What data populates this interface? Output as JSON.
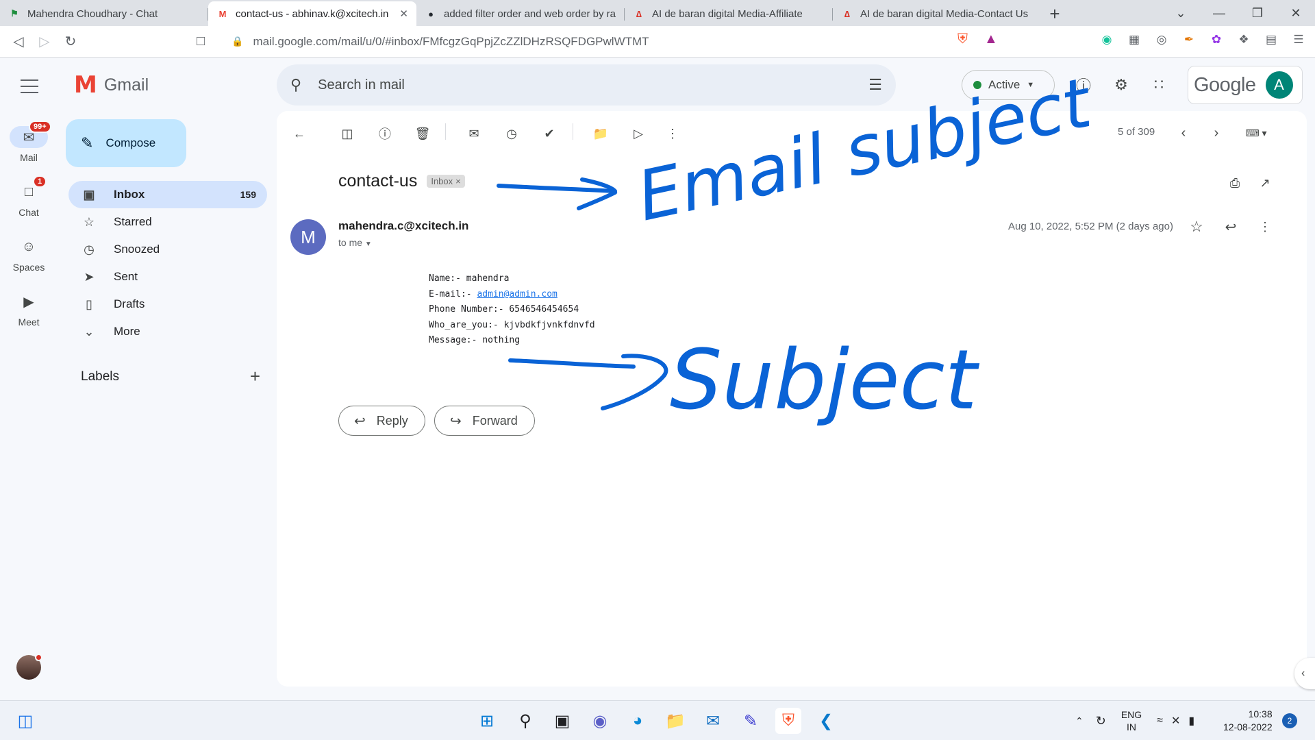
{
  "browser": {
    "tabs": [
      {
        "title": "Mahendra Choudhary - Chat",
        "active": false
      },
      {
        "title": "contact-us - abhinav.k@xcitech.in",
        "active": true
      },
      {
        "title": "added filter order and web order by ra",
        "active": false
      },
      {
        "title": "AI de baran digital Media-Affiliate",
        "active": false
      },
      {
        "title": "AI de baran digital Media-Contact Us",
        "active": false
      }
    ],
    "url": "mail.google.com/mail/u/0/#inbox/FMfcgzGqPpjZcZZlDHzRSQFDGPwlWTMT"
  },
  "gmail": {
    "logo_text": "Gmail",
    "search_placeholder": "Search in mail",
    "status": "Active",
    "google_word": "Google",
    "account_initial": "A",
    "compose": "Compose",
    "rail": [
      {
        "label": "Mail",
        "badge": "99+"
      },
      {
        "label": "Chat",
        "badge": "1"
      },
      {
        "label": "Spaces",
        "badge": ""
      },
      {
        "label": "Meet",
        "badge": ""
      }
    ],
    "nav": [
      {
        "label": "Inbox",
        "count": "159"
      },
      {
        "label": "Starred",
        "count": ""
      },
      {
        "label": "Snoozed",
        "count": ""
      },
      {
        "label": "Sent",
        "count": ""
      },
      {
        "label": "Drafts",
        "count": ""
      },
      {
        "label": "More",
        "count": ""
      }
    ],
    "labels_heading": "Labels",
    "pager": "5 of 309"
  },
  "message": {
    "subject": "contact-us",
    "chip": "Inbox",
    "avatar_initial": "M",
    "sender": "mahendra.c@xcitech.in",
    "to": "to me",
    "date": "Aug 10, 2022, 5:52 PM (2 days ago)",
    "body": {
      "name_label": "Name:- ",
      "name": "mahendra",
      "email_label": "E-mail:- ",
      "email": "admin@admin.com",
      "phone": "Phone Number:- 6546546454654",
      "who": "Who_are_you:- kjvbdkfjvnkfdnvfd",
      "message": "Message:- nothing"
    },
    "reply": "Reply",
    "forward": "Forward"
  },
  "annotations": {
    "top": "Email subject",
    "bottom": "Subject",
    "ink_color": "#0a63d6"
  },
  "taskbar": {
    "lang1": "ENG",
    "lang2": "IN",
    "time": "10:38",
    "date": "12-08-2022",
    "notifications": "2"
  }
}
